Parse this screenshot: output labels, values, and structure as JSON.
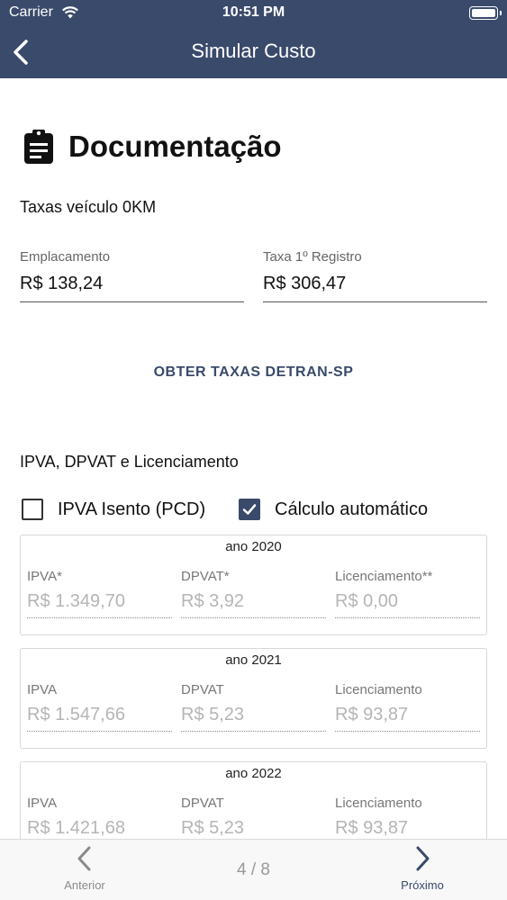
{
  "status_bar": {
    "carrier": "Carrier",
    "time": "10:51 PM"
  },
  "navbar": {
    "title": "Simular Custo"
  },
  "section": {
    "title": "Documentação"
  },
  "taxas": {
    "subtitle": "Taxas veículo 0KM",
    "emplacamento": {
      "label": "Emplacamento",
      "value": "R$ 138,24"
    },
    "registro": {
      "label": "Taxa 1º Registro",
      "value": "R$ 306,47"
    }
  },
  "detran_button": "OBTER TAXAS DETRAN-SP",
  "ipva_section": {
    "subtitle": "IPVA, DPVAT e Licenciamento",
    "isento": {
      "label": "IPVA Isento (PCD)",
      "checked": false
    },
    "automatico": {
      "label": "Cálculo automático",
      "checked": true
    }
  },
  "years": [
    {
      "title": "ano 2020",
      "ipva_label": "IPVA*",
      "ipva": "R$ 1.349,70",
      "dpvat_label": "DPVAT*",
      "dpvat": "R$ 3,92",
      "lic_label": "Licenciamento**",
      "lic": "R$ 0,00"
    },
    {
      "title": "ano 2021",
      "ipva_label": "IPVA",
      "ipva": "R$ 1.547,66",
      "dpvat_label": "DPVAT",
      "dpvat": "R$ 5,23",
      "lic_label": "Licenciamento",
      "lic": "R$ 93,87"
    },
    {
      "title": "ano 2022",
      "ipva_label": "IPVA",
      "ipva": "R$ 1.421,68",
      "dpvat_label": "DPVAT",
      "dpvat": "R$ 5,23",
      "lic_label": "Licenciamento",
      "lic": "R$ 93,87"
    }
  ],
  "bottom_nav": {
    "prev": "Anterior",
    "pager": "4 / 8",
    "next": "Próximo"
  },
  "colors": {
    "primary": "#3a4a6b",
    "muted": "#b5b5b5"
  },
  "icons": [
    "back-chevron-icon",
    "clipboard-icon",
    "checkmark-icon",
    "chevron-left-icon",
    "chevron-right-icon",
    "wifi-icon",
    "battery-icon"
  ]
}
